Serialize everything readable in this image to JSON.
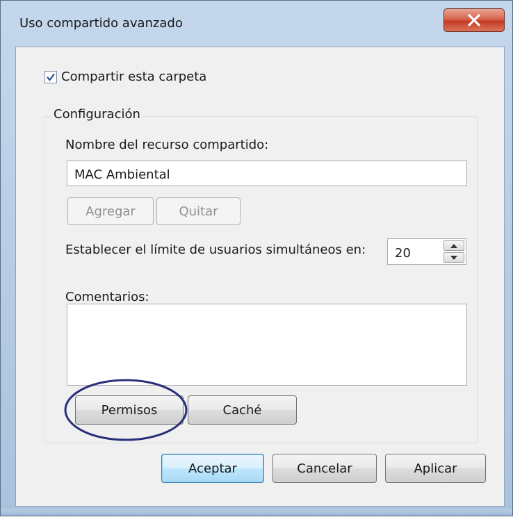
{
  "window": {
    "title": "Uso compartido avanzado"
  },
  "share": {
    "checkbox_label": "Compartir esta carpeta",
    "checked": true
  },
  "config": {
    "group_label": "Configuración",
    "share_name_label": "Nombre del recurso compartido:",
    "share_name_value": "MAC Ambiental",
    "add_label": "Agregar",
    "remove_label": "Quitar",
    "limit_label": "Establecer el límite de usuarios simultáneos en:",
    "limit_value": "20",
    "comments_label": "Comentarios:",
    "comments_value": "",
    "permissions_label": "Permisos",
    "cache_label": "Caché"
  },
  "footer": {
    "ok_label": "Aceptar",
    "cancel_label": "Cancelar",
    "apply_label": "Aplicar"
  },
  "colors": {
    "annotation": "#2a2f7a",
    "title_gradient_top": "#c4d7ec",
    "close_red": "#c43c25"
  },
  "icons": {
    "close": "close-icon",
    "check": "checkmark-icon",
    "spin_up": "spin-up-icon",
    "spin_down": "spin-down-icon"
  }
}
